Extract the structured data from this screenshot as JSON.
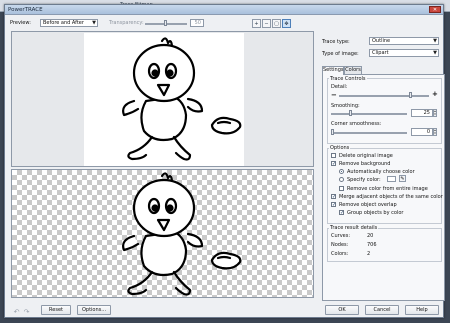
{
  "window": {
    "title": "PowerTRACE",
    "close_glyph": "✕"
  },
  "background_app": {
    "tabs": [
      "Trace Bitmap"
    ]
  },
  "preview": {
    "label": "Preview:",
    "mode": "Before and After",
    "transparency_label": "Transparency:",
    "transparency_value": "50"
  },
  "zoom": {
    "zoom_in_glyph": "+",
    "zoom_out_glyph": "−",
    "fit_glyph": "▢",
    "pan_glyph": "✥"
  },
  "trace_type": {
    "label": "Trace type:",
    "value": "Outline"
  },
  "type_of_image": {
    "label": "Type of image:",
    "value": "Clipart"
  },
  "tabs": [
    "Settings",
    "Colors"
  ],
  "trace_controls": {
    "heading": "Trace Controls",
    "detail_label": "Detail:",
    "minus": "−",
    "plus": "+",
    "detail_level": 0.8,
    "smoothing_label": "Smoothing:",
    "smoothing_value": "25",
    "smoothing_level": 0.25,
    "corner_label": "Corner smoothness:",
    "corner_value": "0",
    "corner_level": 0
  },
  "options": {
    "heading": "Options",
    "delete_original": {
      "label": "Delete original image",
      "checked": false
    },
    "remove_background": {
      "label": "Remove background",
      "checked": true
    },
    "auto_color": {
      "label": "Automatically choose color",
      "selected": true
    },
    "specify_color": {
      "label": "Specify color:",
      "selected": false
    },
    "remove_entire": {
      "label": "Remove color from entire image",
      "checked": false
    },
    "merge_adjacent": {
      "label": "Merge adjacent objects of the same color",
      "checked": true
    },
    "remove_overlap": {
      "label": "Remove object overlap",
      "checked": true
    },
    "group_by_color": {
      "label": "Group objects by color",
      "checked": true
    }
  },
  "results": {
    "heading": "Trace result details",
    "curves_label": "Curves:",
    "curves_value": "20",
    "nodes_label": "Nodes:",
    "nodes_value": "706",
    "colors_label": "Colors:",
    "colors_value": "2"
  },
  "buttons": {
    "reset": "Reset",
    "options": "Options...",
    "ok": "OK",
    "cancel": "Cancel",
    "help": "Help",
    "undo_glyph": "↶",
    "redo_glyph": "↷"
  },
  "colors": {
    "accent": "#1c3d66",
    "title_bar": "#b4c8e2"
  }
}
